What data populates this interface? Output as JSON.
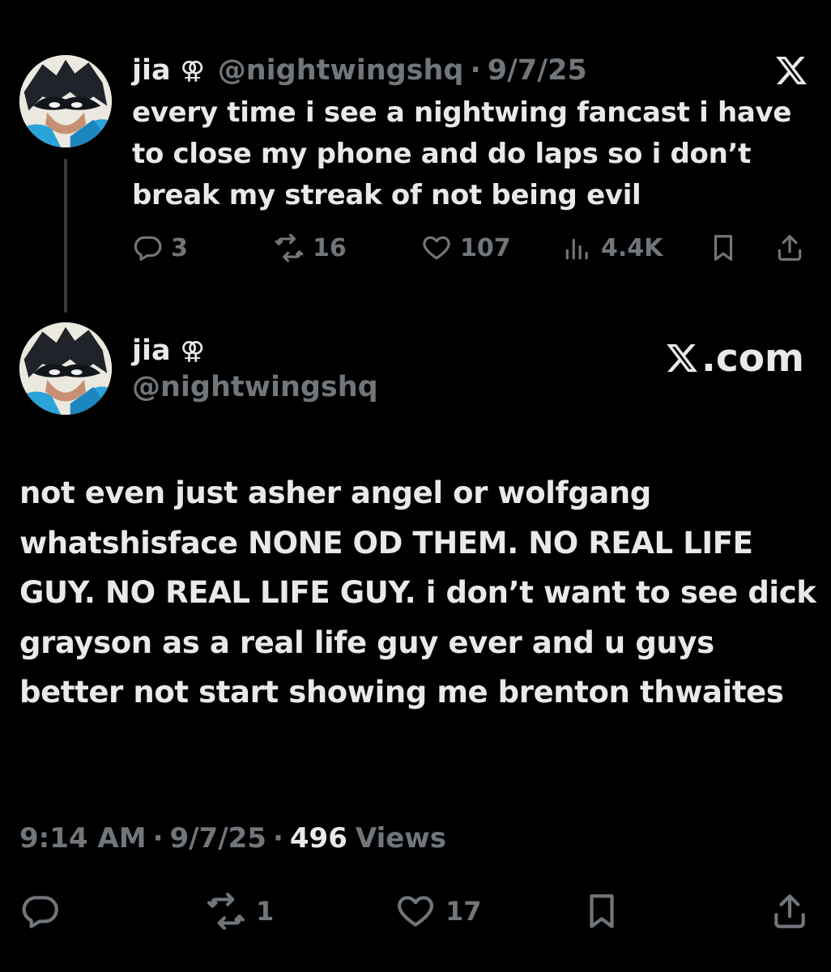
{
  "thread": {
    "parent": {
      "author_name": "jia",
      "author_symbol": "⚢",
      "handle": "@nightwingshq",
      "separator": "·",
      "date": "9/7/25",
      "text": "every time i see a nightwing fancast i have to close my phone and do laps so i don’t break my streak of not being evil",
      "replies": "3",
      "reposts": "16",
      "likes": "107",
      "views": "4.4K",
      "logo_icon": "x-logo-icon"
    },
    "main": {
      "author_name": "jia",
      "author_symbol": "⚢",
      "handle": "@nightwingshq",
      "brand": ".com",
      "text": "not even just asher angel or wolfgang whatshisface NONE OD THEM. NO REAL LIFE GUY. NO REAL LIFE GUY. i don’t want to see dick grayson as a real life guy ever and u guys better not start showing me brenton thwaites",
      "time": "9:14 AM",
      "separator": "·",
      "date": "9/7/25",
      "views_count": "496",
      "views_label": "Views",
      "reposts": "1",
      "likes": "17"
    }
  },
  "colors": {
    "background": "#000000",
    "primary_text": "#e7e9ea",
    "secondary_text": "#71767b",
    "thread_line": "#3a3b3c"
  }
}
